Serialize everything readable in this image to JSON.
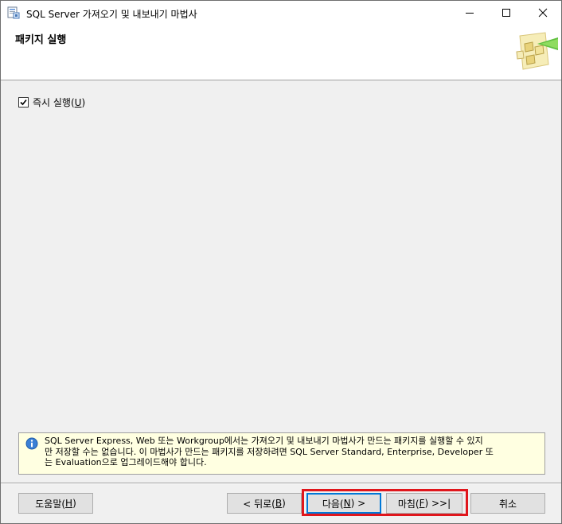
{
  "window": {
    "title": "SQL Server 가져오기 및 내보내기 마법사",
    "controls": {
      "minimize": "minimize",
      "maximize": "maximize",
      "close": "close"
    }
  },
  "header": {
    "title": "패키지 실행"
  },
  "options": {
    "run_immediately_label": "즉시 실행(",
    "run_immediately_key": "U",
    "run_immediately_suffix": ")",
    "run_immediately_checked": true
  },
  "info": {
    "line1": "SQL Server Express, Web 또는 Workgroup에서는 가져오기 및 내보내기 마법사가 만드는 패키지를 실행할 수 있지",
    "line2": "만 저장할 수는 없습니다. 이 마법사가 만드는 패키지를 저장하려면 SQL Server Standard, Enterprise, Developer 또",
    "line3": "는 Evaluation으로 업그레이드해야 합니다."
  },
  "buttons": {
    "help": {
      "pre": "도움말(",
      "key": "H",
      "post": ")"
    },
    "back": {
      "pre": "< 뒤로(",
      "key": "B",
      "post": ")"
    },
    "next": {
      "pre": "다음(",
      "key": "N",
      "post": ") >"
    },
    "finish": {
      "pre": "마침(",
      "key": "F",
      "post": ") >>|"
    },
    "cancel": {
      "label": "취소"
    }
  },
  "colors": {
    "highlight": "#e0161c",
    "info_background": "#ffffe1",
    "window_background": "#f0f0f0"
  }
}
